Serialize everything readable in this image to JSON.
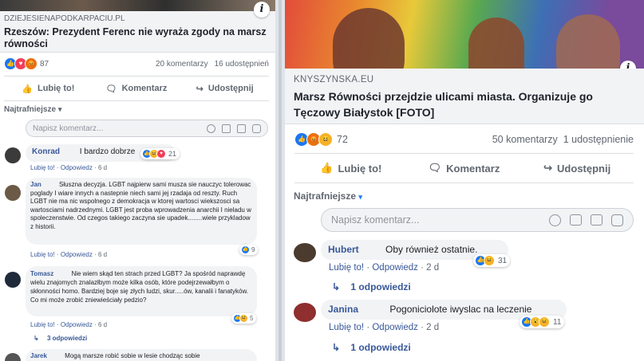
{
  "left": {
    "domain": "DZIEJESIENAPODKARPACIU.PL",
    "headline": "Rzeszów: Prezydent Ferenc nie wyraża zgody na marsz równości",
    "reactions_count": "87",
    "comments_count": "20 komentarzy",
    "shares_count": "16 udostępnień",
    "actions": {
      "like": "Lubię to!",
      "comment": "Komentarz",
      "share": "Udostępnij"
    },
    "sort_label": "Najtrafniejsze",
    "comment_placeholder": "Napisz komentarz...",
    "comments": [
      {
        "author": "Konrad",
        "text": "I bardzo dobrze",
        "like": "Lubię to!",
        "reply": "Odpowiedz",
        "time": "6 d",
        "reactions": "21"
      },
      {
        "author": "Jan",
        "text": "Słuszna decyzja. LGBT najpierw sami musza sie nauczyc tolerowac poglady I wiare innych a nastepnie niech sami jej rzadaja od reszty. Ruch LGBT nie ma nic wspolnego z demokracja w ktorej wartosci wiekszosci sa wartosciami nadrzednymi. LGBT jest proba wprowadzenia anarchii I nieladu w spoleczenstwie. Od czegos takiego zaczyna sie upadek........wiele przykladow z historii.",
        "like": "Lubię to!",
        "reply": "Odpowiedz",
        "time": "6 d",
        "reactions": "9"
      },
      {
        "author": "Tomasz",
        "text": "Nie wiem skąd ten strach przed LGBT? Ja spośród naprawdę wielu znajomych znalazłbym może kilka osób, które podejrzewałbym o skłonności homo. Bardziej boje się złych ludzi, skur.....ów, kanalii i fanatyków. Co mi może zrobić zniewieściały pedzio?",
        "like": "Lubię to!",
        "reply": "Odpowiedz",
        "time": "6 d",
        "reactions": "5",
        "replies": "3 odpowiedzi"
      },
      {
        "author": "Jarek",
        "text": "Mogą marsze robić sobie w lesie chodząc sobie"
      }
    ]
  },
  "right": {
    "domain": "KNYSZYNSKA.EU",
    "headline": "Marsz Równości przejdzie ulicami miasta. Organizuje go Tęczowy Białystok [FOTO]",
    "reactions_count": "72",
    "comments_count": "50 komentarzy",
    "shares_count": "1 udostępnienie",
    "actions": {
      "like": "Lubię to!",
      "comment": "Komentarz",
      "share": "Udostępnij"
    },
    "sort_label": "Najtrafniejsze",
    "comment_placeholder": "Napisz komentarz...",
    "comments": [
      {
        "author": "Hubert",
        "text": "Oby również ostatnie.",
        "like": "Lubię to!",
        "reply": "Odpowiedz",
        "time": "2 d",
        "reactions": "31",
        "replies": "1 odpowiedzi"
      },
      {
        "author": "Janina",
        "text": "Pogoniciolote iwyslac na leczenie",
        "like": "Lubię to!",
        "reply": "Odpowiedz",
        "time": "2 d",
        "reactions": "11",
        "replies": "1 odpowiedzi"
      }
    ]
  },
  "icons": [
    "info-icon",
    "like-icon",
    "comment-icon",
    "share-icon",
    "emoji-icon",
    "camera-icon",
    "gif-icon",
    "sticker-icon",
    "reply-arrow-icon"
  ],
  "colors": {
    "link": "#385898",
    "like_blue": "#1877f2",
    "love_red": "#f33e58",
    "haha_yellow": "#f7b125",
    "bubble": "#f2f3f5"
  }
}
